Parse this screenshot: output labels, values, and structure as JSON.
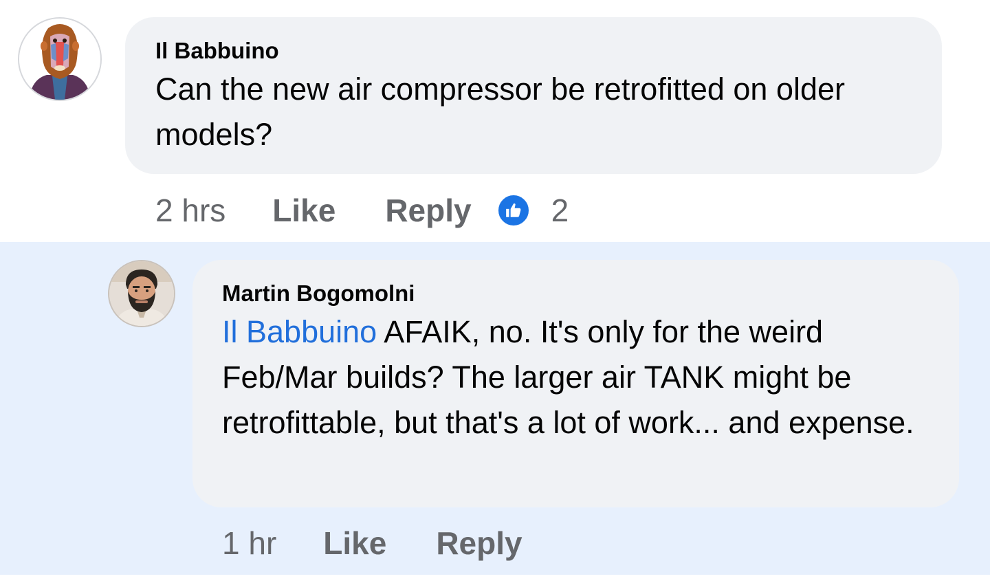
{
  "comment": {
    "author": "Il Babbuino",
    "text": "Can the new air compressor be retrofitted on older models?",
    "time": "2 hrs",
    "like_label": "Like",
    "reply_label": "Reply",
    "reaction_icon": "like-thumbs-up-icon",
    "reaction_count": "2"
  },
  "reply": {
    "author": "Martin Bogomolni",
    "mention": "Il Babbuino",
    "text": " AFAIK, no.  It's only for the weird Feb/Mar builds?  The larger air TANK might be retrofittable, but that's a lot of work... and expense.",
    "time": "1 hr",
    "like_label": "Like",
    "reply_label": "Reply"
  },
  "colors": {
    "bubble": "#f0f2f5",
    "highlight_bg": "#e7f0fd",
    "mention": "#216fdb",
    "meta": "#65676b",
    "like_blue": "#1b74e4"
  }
}
